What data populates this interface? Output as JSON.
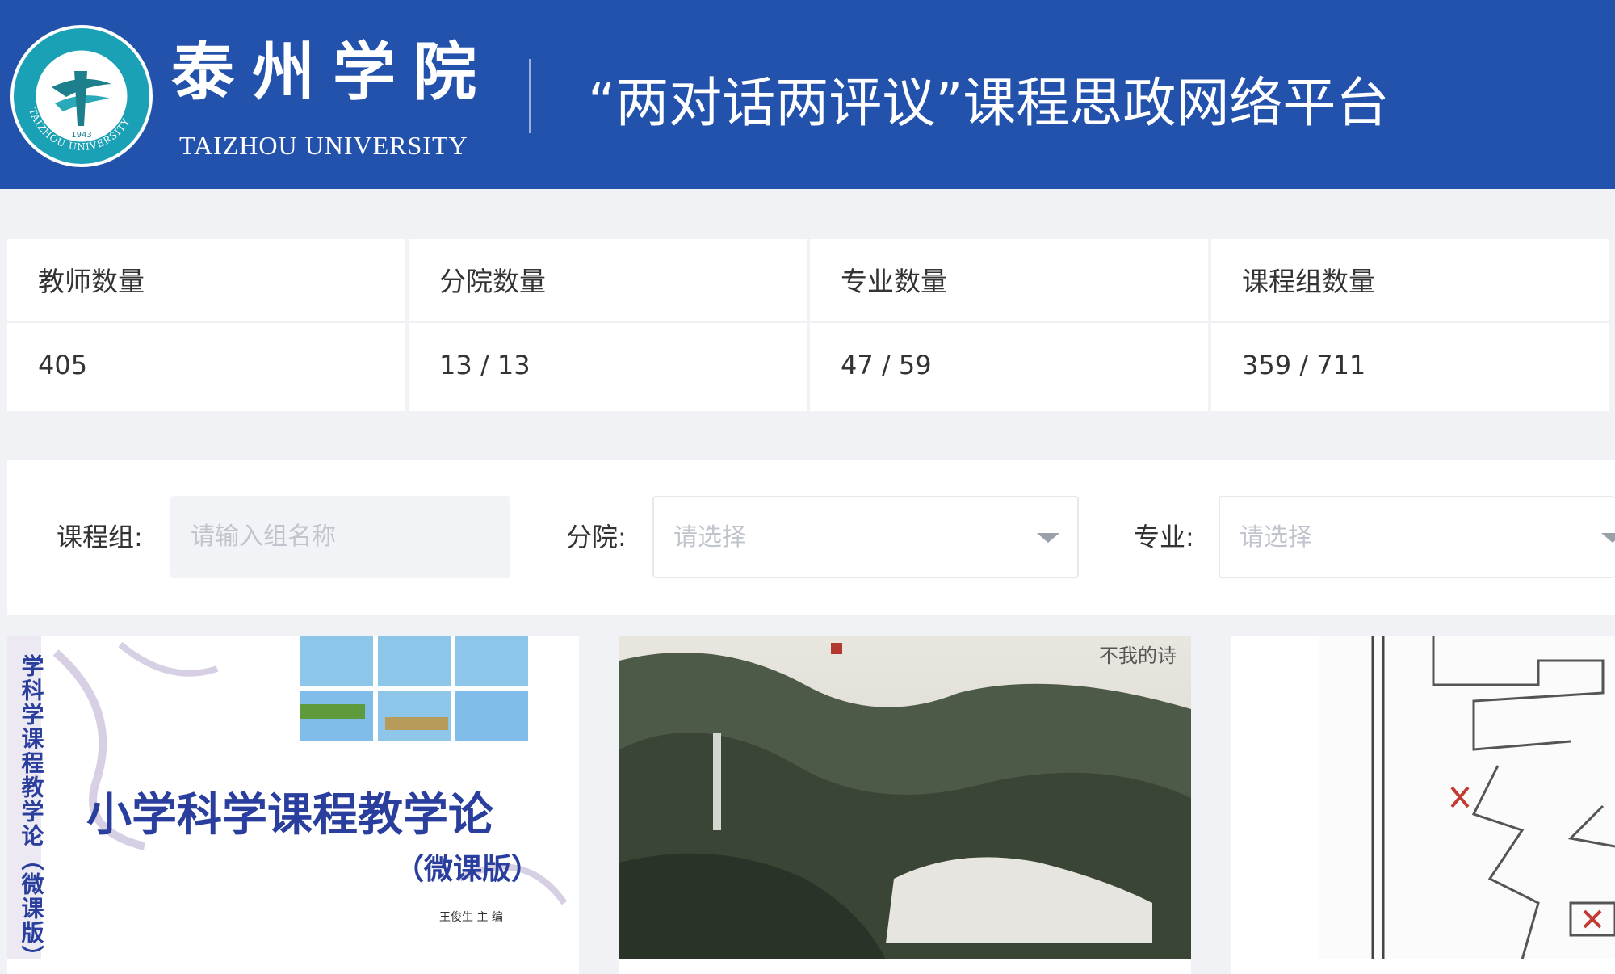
{
  "header": {
    "university_cn": "泰州学院",
    "university_en": "TAIZHOU  UNIVERSITY",
    "platform_title": "“两对话两评议”课程思政网络平台",
    "badge_year": "1943",
    "badge_en": "TAIZHOU UNIVERSITY",
    "colors": {
      "bar": "#2352ad",
      "text": "#ffffff"
    }
  },
  "stats": [
    {
      "label": "教师数量",
      "value": "405"
    },
    {
      "label": "分院数量",
      "value": "13 / 13"
    },
    {
      "label": "专业数量",
      "value": "47 / 59"
    },
    {
      "label": "课程组数量",
      "value": "359 / 711"
    }
  ],
  "filters": {
    "group": {
      "label": "课程组:",
      "placeholder": "请输入组名称"
    },
    "college": {
      "label": "分院:",
      "placeholder": "请选择"
    },
    "major": {
      "label": "专业:",
      "placeholder": "请选择"
    }
  },
  "cards": [
    {
      "image": "course-book-cover",
      "cover_title": "小学科学课程教学论",
      "cover_subtitle": "（微课版）",
      "cover_author": "王俊生  主  编",
      "cover_spine": "学科学课程教学论（微课版）"
    },
    {
      "image": "landscape-painting",
      "painting_inscription": "不我的诗"
    },
    {
      "image": "line-drawing"
    }
  ]
}
